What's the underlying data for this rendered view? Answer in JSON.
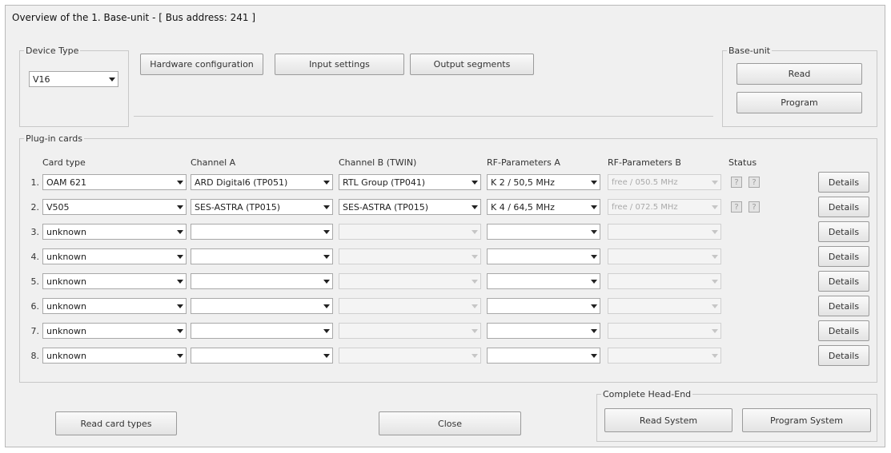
{
  "window": {
    "title": "Overview of the 1. Base-unit - [ Bus address: 241 ]"
  },
  "device_type": {
    "legend": "Device Type",
    "value": "V16"
  },
  "tabs": [
    {
      "label": "Hardware configuration"
    },
    {
      "label": "Input settings"
    },
    {
      "label": "Output segments"
    }
  ],
  "base_unit": {
    "legend": "Base-unit",
    "read_label": "Read",
    "program_label": "Program"
  },
  "plugin": {
    "legend": "Plug-in cards",
    "columns": {
      "card_type": "Card type",
      "channel_a": "Channel A",
      "channel_b": "Channel B (TWIN)",
      "rf_a": "RF-Parameters A",
      "rf_b": "RF-Parameters B",
      "status": "Status"
    },
    "status_glyph": "?",
    "details_label": "Details",
    "rows": [
      {
        "num": "1.",
        "card_type": "OAM 621",
        "channel_a": "ARD Digital6 (TP051)",
        "channel_b": "RTL Group (TP041)",
        "rf_a": "K 2 / 50,5 MHz",
        "rf_b": "free / 050.5 MHz",
        "status": true
      },
      {
        "num": "2.",
        "card_type": "V505",
        "channel_a": "SES-ASTRA (TP015)",
        "channel_b": "SES-ASTRA (TP015)",
        "rf_a": "K 4 / 64,5 MHz",
        "rf_b": "free / 072.5 MHz",
        "status": true
      },
      {
        "num": "3.",
        "card_type": "unknown",
        "channel_a": "",
        "channel_b": "",
        "rf_a": "",
        "rf_b": "",
        "status": false
      },
      {
        "num": "4.",
        "card_type": "unknown",
        "channel_a": "",
        "channel_b": "",
        "rf_a": "",
        "rf_b": "",
        "status": false
      },
      {
        "num": "5.",
        "card_type": "unknown",
        "channel_a": "",
        "channel_b": "",
        "rf_a": "",
        "rf_b": "",
        "status": false
      },
      {
        "num": "6.",
        "card_type": "unknown",
        "channel_a": "",
        "channel_b": "",
        "rf_a": "",
        "rf_b": "",
        "status": false
      },
      {
        "num": "7.",
        "card_type": "unknown",
        "channel_a": "",
        "channel_b": "",
        "rf_a": "",
        "rf_b": "",
        "status": false
      },
      {
        "num": "8.",
        "card_type": "unknown",
        "channel_a": "",
        "channel_b": "",
        "rf_a": "",
        "rf_b": "",
        "status": false
      }
    ]
  },
  "footer": {
    "read_card_types_label": "Read card types",
    "close_label": "Close",
    "headend_legend": "Complete Head-End",
    "read_system_label": "Read System",
    "program_system_label": "Program System"
  }
}
